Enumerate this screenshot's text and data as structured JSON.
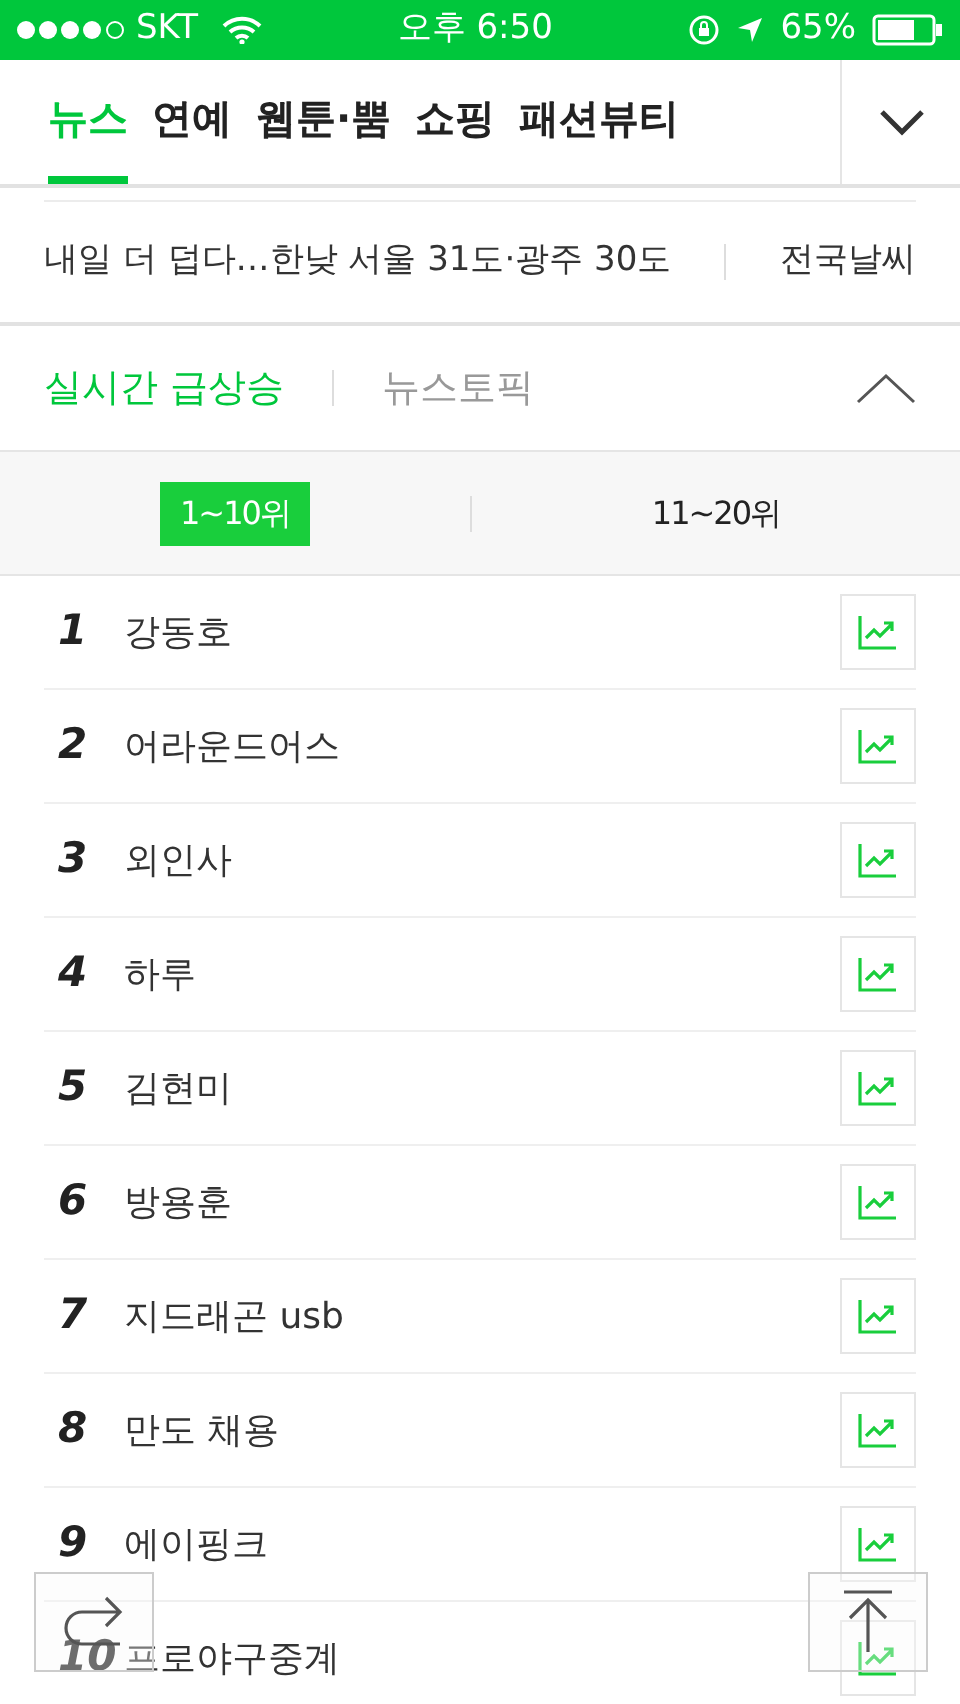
{
  "status_bar": {
    "carrier": "SKT",
    "time": "오후 6:50",
    "battery": "65%"
  },
  "tabs": [
    {
      "label": "뉴스",
      "selected": true
    },
    {
      "label": "연예",
      "selected": false
    },
    {
      "label": "웹툰·뿜",
      "selected": false
    },
    {
      "label": "쇼핑",
      "selected": false
    },
    {
      "label": "패션뷰티",
      "selected": false
    }
  ],
  "headline": {
    "text": "내일 더 덥다…한낮 서울 31도·광주 30도",
    "link": "전국날씨"
  },
  "section": {
    "expanded": true,
    "tabs": [
      {
        "label": "실시간 급상승",
        "selected": true
      },
      {
        "label": "뉴스토픽",
        "selected": false
      }
    ]
  },
  "range_tabs": [
    {
      "label": "1~10위",
      "selected": true
    },
    {
      "label": "11~20위",
      "selected": false
    }
  ],
  "rankings": [
    {
      "rank": "1",
      "keyword": "강동호"
    },
    {
      "rank": "2",
      "keyword": "어라운드어스"
    },
    {
      "rank": "3",
      "keyword": "외인사"
    },
    {
      "rank": "4",
      "keyword": "하루"
    },
    {
      "rank": "5",
      "keyword": "김현미"
    },
    {
      "rank": "6",
      "keyword": "방용훈"
    },
    {
      "rank": "7",
      "keyword": "지드래곤 usb"
    },
    {
      "rank": "8",
      "keyword": "만도 채용"
    },
    {
      "rank": "9",
      "keyword": "에이핑크"
    },
    {
      "rank": "10",
      "keyword": "프로야구중계"
    }
  ]
}
